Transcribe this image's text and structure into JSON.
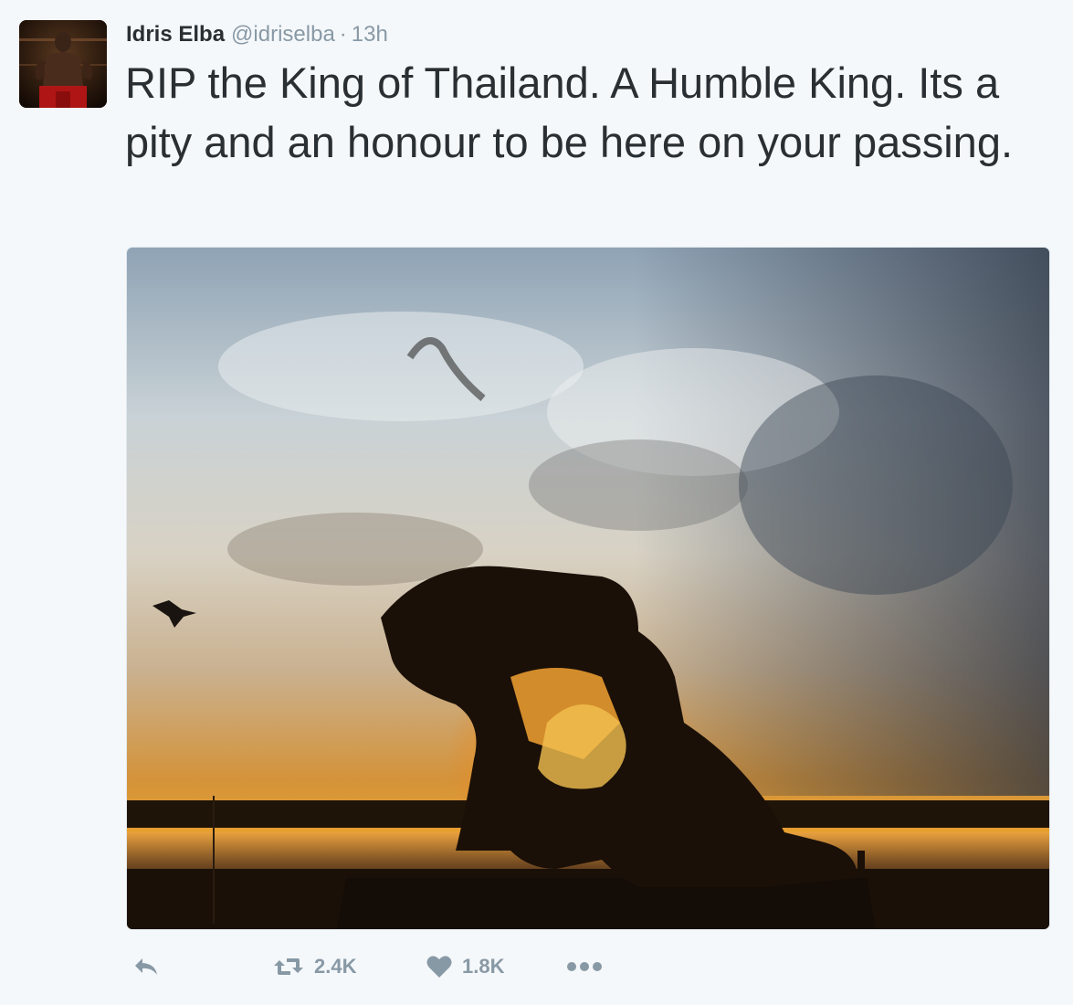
{
  "tweet": {
    "author_name": "Idris Elba",
    "author_handle": "@idriselba",
    "separator": "·",
    "timestamp": "13h",
    "text": "RIP the King of Thailand. A Humble King. Its a pity and an honour to be here on your passing.",
    "avatar_icon": "boxer-avatar",
    "media_icon": "sunset-statue-photo"
  },
  "actions": {
    "reply_icon": "reply-icon",
    "retweet_icon": "retweet-icon",
    "retweet_count": "2.4K",
    "like_icon": "heart-icon",
    "like_count": "1.8K",
    "more_icon": "more-icon"
  },
  "colors": {
    "background": "#f5f8fa",
    "text": "#292f33",
    "muted": "#8899a6"
  }
}
